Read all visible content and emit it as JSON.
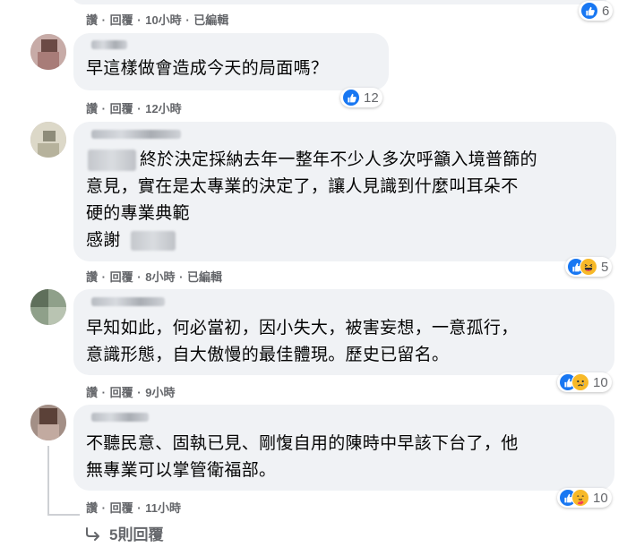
{
  "actions": {
    "like": "讚",
    "reply": "回覆",
    "edited": "已編輯",
    "dot": "·"
  },
  "colors": {
    "like_blue": "#1877f2",
    "emoji_yellow": "#f7b928",
    "bubble_bg": "#f0f2f5",
    "meta_gray": "#65676b"
  },
  "comments": [
    {
      "lines": [],
      "time": "10小時",
      "edited": true,
      "reactions": {
        "icons": [
          "like-icon"
        ],
        "count": "6"
      }
    },
    {
      "lines": [
        "早這樣做會造成今天的局面嗎？"
      ],
      "time": "12小時",
      "edited": false,
      "reactions": {
        "icons": [
          "like-icon"
        ],
        "count": "12"
      }
    },
    {
      "lines": [
        "終於決定採納去年一整年不少人多次呼籲入境普篩的",
        "意見，實在是太專業的決定了，讓人見識到什麼叫耳朵不",
        "硬的專業典範",
        "感謝"
      ],
      "time": "8小時",
      "edited": true,
      "reactions": {
        "icons": [
          "like-icon",
          "haha-icon"
        ],
        "count": "5"
      }
    },
    {
      "lines": [
        "早知如此，何必當初，因小失大，被害妄想，一意孤行，",
        "意識形態，自大傲慢的最佳體現。歷史已留名。"
      ],
      "time": "9小時",
      "edited": false,
      "reactions": {
        "icons": [
          "like-icon",
          "sad-icon"
        ],
        "count": "10"
      }
    },
    {
      "lines": [
        "不聽民意、固執已見、剛愎自用的陳時中早該下台了，他",
        "無專業可以掌管衛福部。"
      ],
      "time": "11小時",
      "edited": false,
      "reactions": {
        "icons": [
          "like-icon",
          "care-icon"
        ],
        "count": "10"
      }
    }
  ],
  "replies_link": "5則回覆"
}
